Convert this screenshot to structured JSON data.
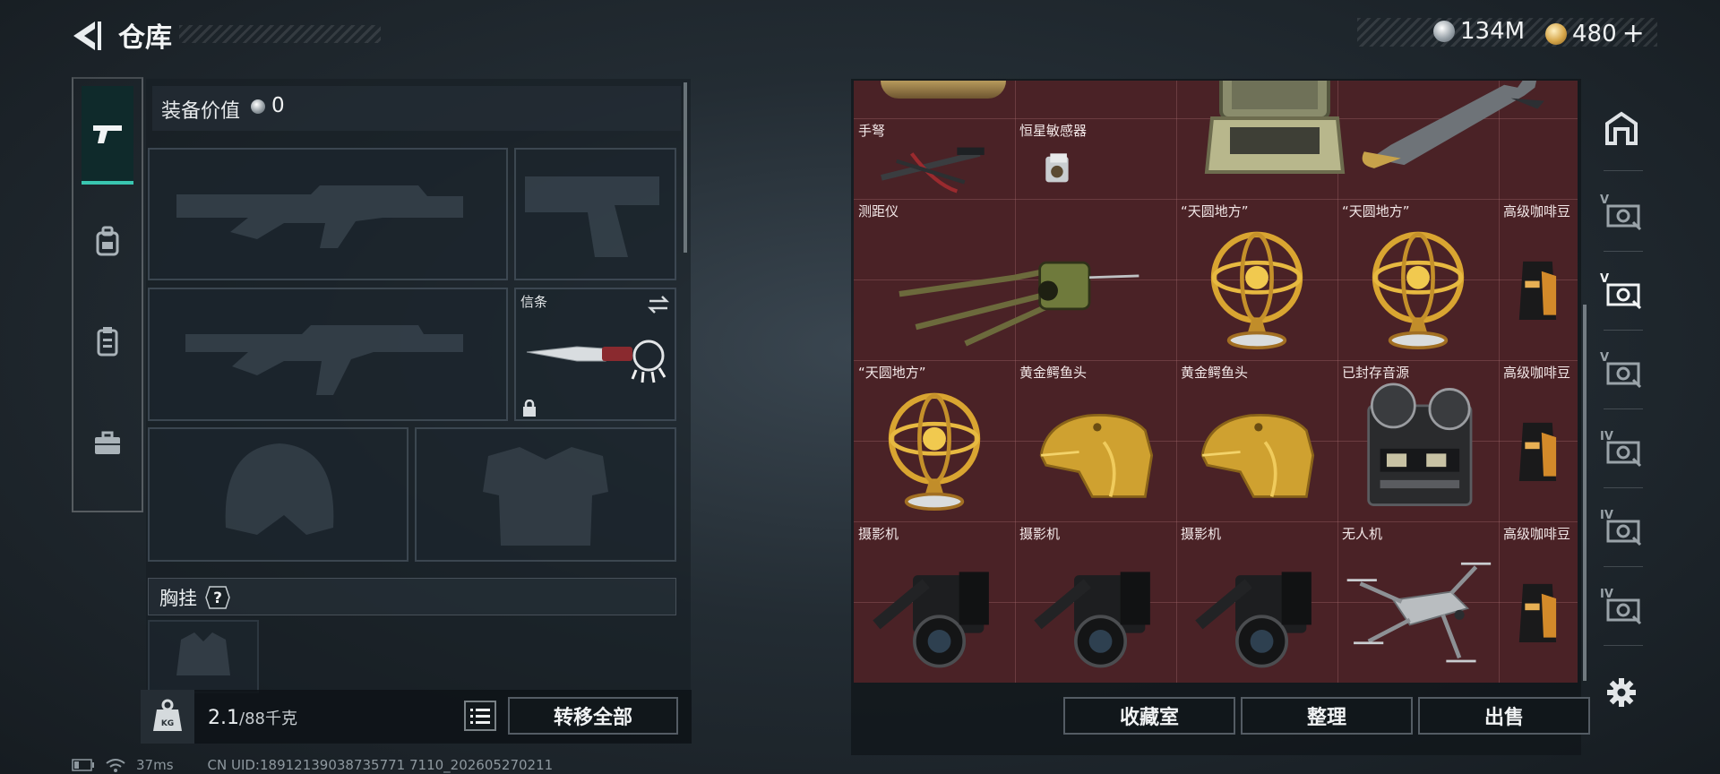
{
  "header": {
    "title": "仓库",
    "currency_silver": "134M",
    "currency_gold": "480",
    "gold_plus": "+"
  },
  "equipment": {
    "value_label": "装备价值",
    "value": "0",
    "melee_label": "信条",
    "chest_label": "胸挂",
    "chest_help": "?"
  },
  "bottom_left": {
    "weight_icon_text": "KG",
    "weight_current": "2.1",
    "weight_capacity": "/88千克",
    "transfer_all": "转移全部"
  },
  "stash": {
    "items": [
      {
        "label": "手弩",
        "icon": "crossbow"
      },
      {
        "label": "恒星敏感器",
        "icon": "star-sensor"
      },
      {
        "label": "",
        "icon": "rugged-case"
      },
      {
        "label": "",
        "icon": "missile"
      },
      {
        "label": "测距仪",
        "icon": "rangefinder"
      },
      {
        "label": "“天圆地方”",
        "icon": "armillary-sphere"
      },
      {
        "label": "“天圆地方”",
        "icon": "armillary-sphere"
      },
      {
        "label": "高级咖啡豆",
        "icon": "coffee-bag"
      },
      {
        "label": "“天圆地方”",
        "icon": "armillary-sphere"
      },
      {
        "label": "黄金鳄鱼头",
        "icon": "golden-crocodile-head"
      },
      {
        "label": "黄金鳄鱼头",
        "icon": "golden-crocodile-head"
      },
      {
        "label": "已封存音源",
        "icon": "reel-recorder"
      },
      {
        "label": "高级咖啡豆",
        "icon": "coffee-bag"
      },
      {
        "label": "摄影机",
        "icon": "film-camera"
      },
      {
        "label": "摄影机",
        "icon": "film-camera"
      },
      {
        "label": "摄影机",
        "icon": "film-camera"
      },
      {
        "label": "无人机",
        "icon": "drone"
      },
      {
        "label": "高级咖啡豆",
        "icon": "coffee-bag"
      }
    ],
    "collection_button": "收藏室",
    "sort_button": "整理",
    "sell_button": "出售"
  },
  "right_rail": {
    "ranks": [
      "V",
      "V",
      "V",
      "IV",
      "IV",
      "IV"
    ]
  },
  "status": {
    "ping": "37ms",
    "uid": "CN UID:18912139038735771 7110_202605270211"
  },
  "colors": {
    "accent_teal": "#39c6b0",
    "stash_bg": "#4a2226",
    "gold_item": "#d9a531"
  }
}
